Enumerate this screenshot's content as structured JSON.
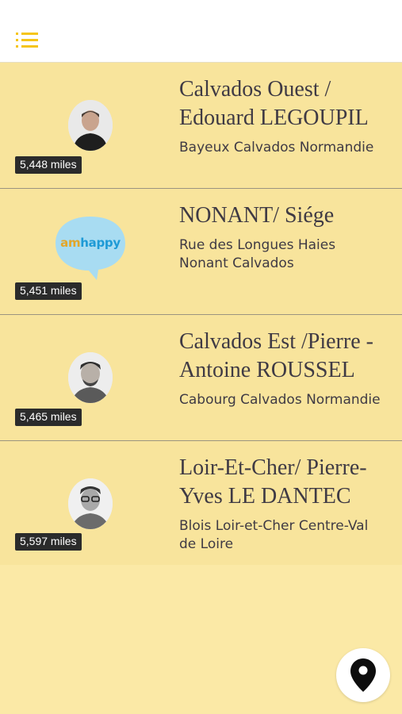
{
  "header": {
    "menu_icon": "list-icon"
  },
  "colors": {
    "accent": "#f5c518",
    "item_bg": "#f8e49c",
    "page_bg": "#fbe9a6"
  },
  "items": [
    {
      "name": "Calvados Ouest / Edouard LEGOUPIL",
      "address_lines": [
        "Bayeux Calvados Normandie"
      ],
      "distance": "5,448 miles",
      "image": "person-avatar"
    },
    {
      "name": "NONANT/ Siége",
      "address_lines": [
        "Rue des Longues Haies",
        "Nonant Calvados"
      ],
      "distance": "5,451 miles",
      "image": "amhappy-logo",
      "logo": {
        "part1": "am",
        "part2": "happy"
      }
    },
    {
      "name": "Calvados Est /Pierre - Antoine ROUSSEL",
      "address_lines": [
        "Cabourg Calvados Normandie"
      ],
      "distance": "5,465 miles",
      "image": "person-avatar"
    },
    {
      "name": "Loir-Et-Cher/ Pierre-Yves LE DANTEC",
      "address_lines": [
        "Blois Loir-et-Cher Centre-Val",
        "de Loire"
      ],
      "distance": "5,597 miles",
      "image": "person-avatar"
    }
  ],
  "fab": {
    "icon": "map-pin-icon"
  }
}
